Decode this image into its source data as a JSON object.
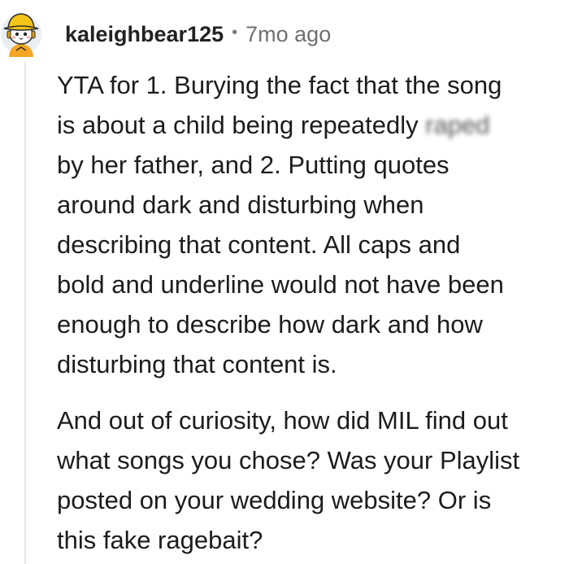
{
  "comment": {
    "username": "kaleighbear125",
    "separator": "•",
    "timestamp": "7mo ago",
    "avatar_icon": "snoo-avatar-icon",
    "paragraphs": [
      {
        "lines": [
          "YTA for 1. Burying the fact that the song",
          {
            "before": "is about a child being repeatedly ",
            "censored": "raped",
            "after": ""
          },
          "by her father, and 2. Putting quotes",
          "around dark and disturbing when",
          "describing that content. All caps and",
          "bold and underline would not have been",
          "enough to describe how dark and how",
          "disturbing that content is."
        ]
      },
      {
        "lines": [
          "And out of curiosity, how did MIL find out",
          "what songs you chose? Was your Playlist",
          "posted on your wedding website? Or is",
          "this fake ragebait?"
        ]
      }
    ]
  },
  "colors": {
    "background": "#ffffff",
    "text": "#1c1c1c",
    "meta": "#6f6f6f",
    "avatar_hat": "#f5c518",
    "avatar_shirt": "#f5a623"
  }
}
